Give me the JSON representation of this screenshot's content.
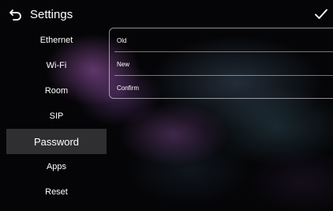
{
  "header": {
    "title": "Settings",
    "back_icon": "back-arrow-icon",
    "confirm_icon": "checkmark-icon"
  },
  "sidebar": {
    "items": [
      {
        "label": "Ethernet",
        "selected": false
      },
      {
        "label": "Wi-Fi",
        "selected": false
      },
      {
        "label": "Room",
        "selected": false
      },
      {
        "label": "SIP",
        "selected": false
      },
      {
        "label": "Password",
        "selected": true
      },
      {
        "label": "Apps",
        "selected": false
      },
      {
        "label": "Reset",
        "selected": false
      }
    ]
  },
  "form": {
    "old": {
      "placeholder": "Old",
      "value": ""
    },
    "new": {
      "placeholder": "New",
      "value": ""
    },
    "confirm": {
      "placeholder": "Confirm",
      "value": ""
    }
  },
  "colors": {
    "background": "#050507",
    "selected_item": "#2f2f32",
    "text": "#ffffff"
  }
}
